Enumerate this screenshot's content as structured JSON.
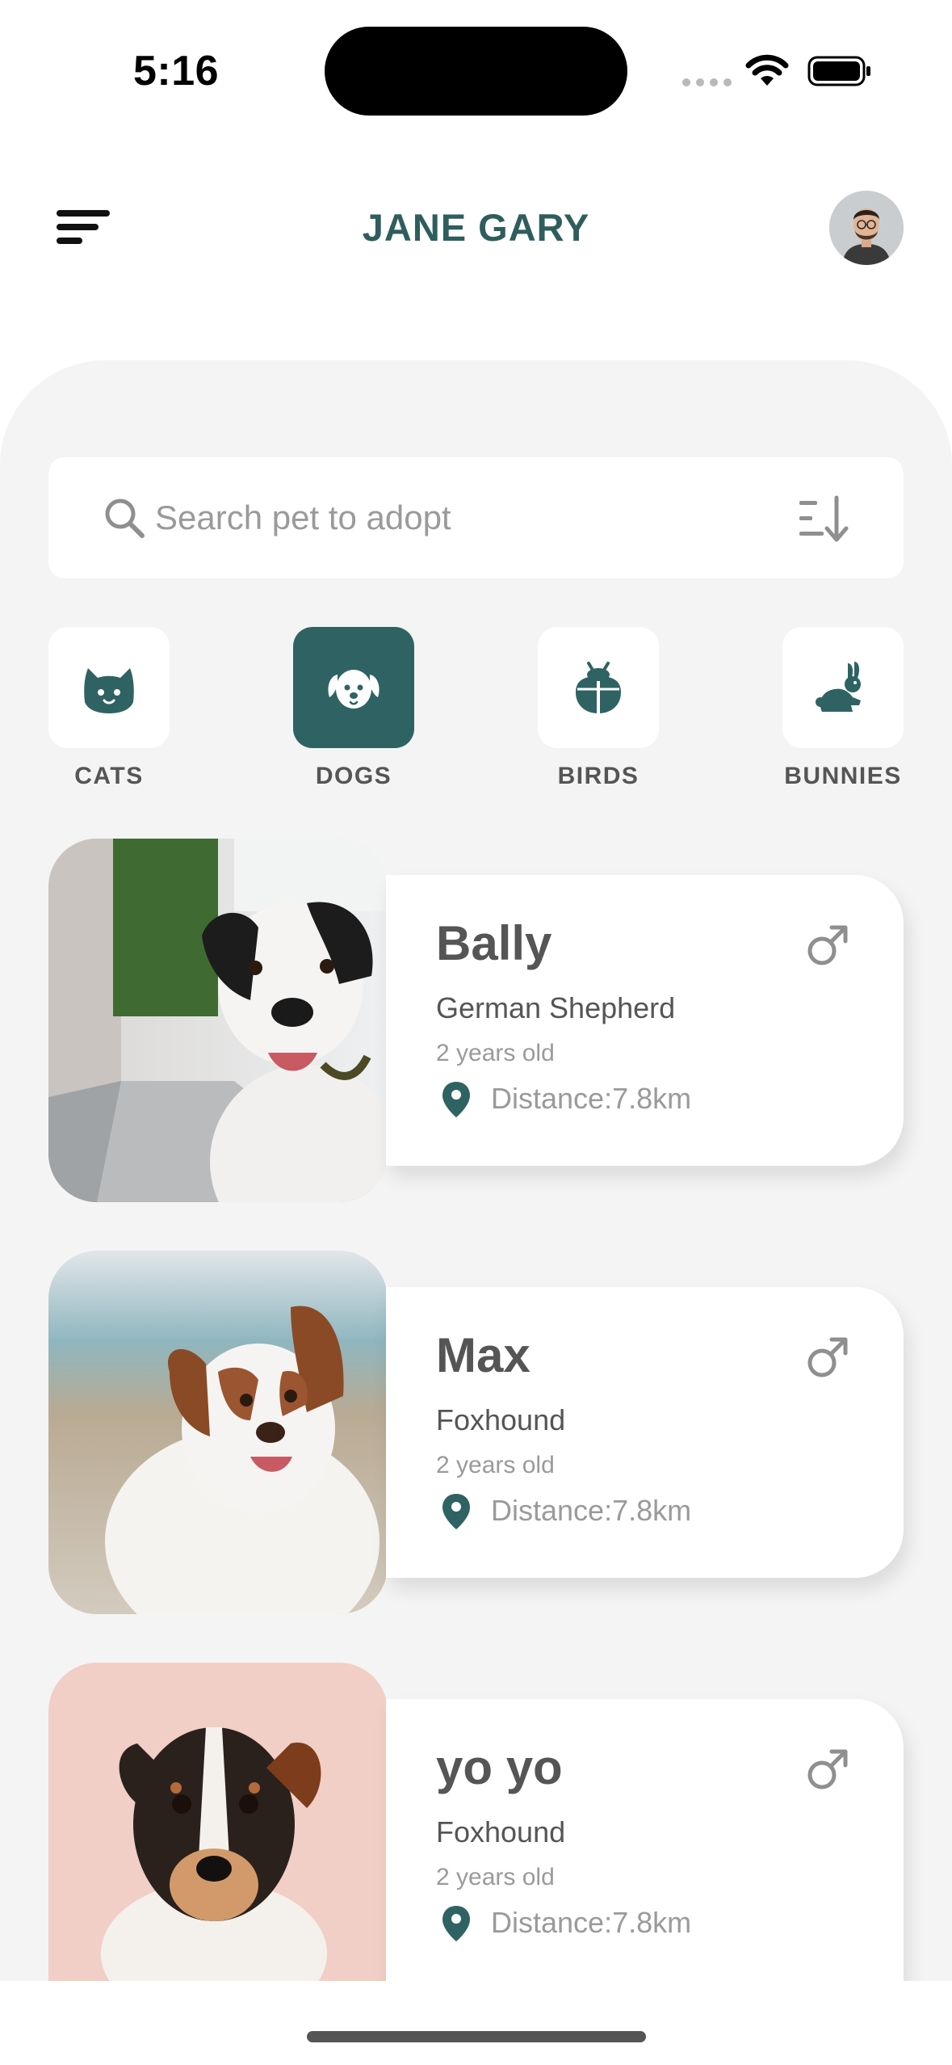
{
  "status_bar": {
    "time": "5:16",
    "icons": [
      "cellular-signal-icon",
      "wifi-icon",
      "battery-icon"
    ]
  },
  "header": {
    "title": "JANE GARY",
    "menu_icon": "menu-icon",
    "avatar": "user-avatar"
  },
  "search": {
    "placeholder": "Search pet to adopt",
    "value": "",
    "icon": "search-icon",
    "sort_icon": "sort-descending-icon"
  },
  "categories": [
    {
      "label": "CATS",
      "icon": "cat-icon",
      "active": false
    },
    {
      "label": "DOGS",
      "icon": "dog-icon",
      "active": true
    },
    {
      "label": "BIRDS",
      "icon": "bird-icon",
      "active": false
    },
    {
      "label": "BUNNIES",
      "icon": "bunny-icon",
      "active": false
    }
  ],
  "pets": [
    {
      "name": "Bally",
      "breed": "German Shepherd",
      "age": "2 years old",
      "distance": "Distance:7.8km",
      "gender_icon": "male-icon"
    },
    {
      "name": "Max",
      "breed": "Foxhound",
      "age": "2 years old",
      "distance": "Distance:7.8km",
      "gender_icon": "male-icon"
    },
    {
      "name": "yo yo",
      "breed": "Foxhound",
      "age": "2 years old",
      "distance": "Distance:7.8km",
      "gender_icon": "male-icon"
    }
  ],
  "colors": {
    "accent": "#2f6363",
    "title": "#2f5d5d",
    "panel_bg": "#f4f4f4",
    "card_bg": "#ffffff",
    "muted_text": "#9a9a9a"
  }
}
